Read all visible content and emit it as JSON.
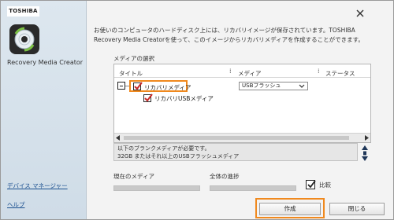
{
  "brand": "TOSHIBA",
  "app_title": "Recovery Media Creator",
  "description": "お使いのコンピュータのハードディスク上には、リカバリイメージが保存されています。TOSHIBA Recovery Media Creatorを使って、このイメージからリカバリメディアを作成することができます。",
  "media_section": {
    "label": "メディアの選択",
    "columns": [
      "タイトル",
      "メディア",
      "ステータス"
    ],
    "items": [
      {
        "label": "リカバリメディア",
        "checked": true,
        "media": "USBフラッシュ"
      },
      {
        "label": "リカバリUSBメディア",
        "checked": true
      }
    ]
  },
  "info": {
    "line1": "以下のブランクメディアが必要です。",
    "line2": "32GB またはそれ以上のUSBフラッシュメディア"
  },
  "progress": {
    "current_label": "現在のメディア",
    "current_value": 0,
    "overall_label": "全体の進捗",
    "overall_value": 0
  },
  "compare": {
    "label": "比較",
    "checked": true
  },
  "sidebar": {
    "device_manager": "デバイス マネージャー",
    "help": "ヘルプ"
  },
  "buttons": {
    "create": "作成",
    "close": "閉じる"
  },
  "colors": {
    "highlight": "#f0891e",
    "link": "#1a4f8f"
  },
  "icons": {
    "close": "close-icon",
    "app": "recovery-disc-icon",
    "dropdown": "chevron-down-icon"
  }
}
